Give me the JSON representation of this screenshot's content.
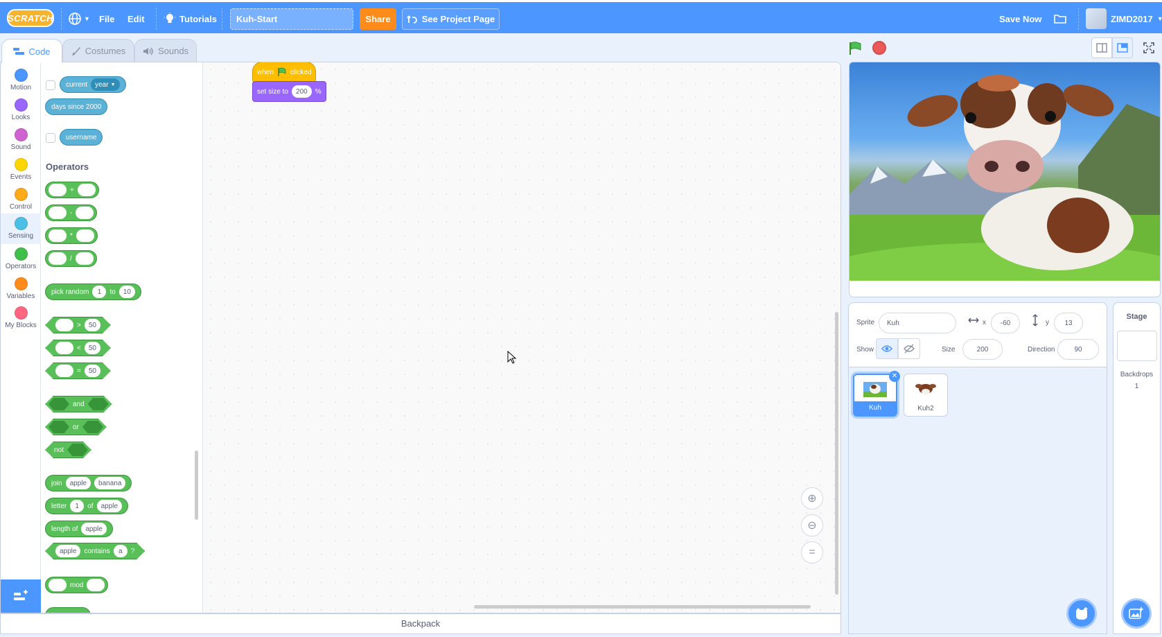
{
  "menubar": {
    "logo": "SCRATCH",
    "file": "File",
    "edit": "Edit",
    "tutorials": "Tutorials",
    "project_title": "Kuh-Start",
    "share": "Share",
    "see_project_page": "See Project Page",
    "save_now": "Save Now",
    "username": "ZIMD2017"
  },
  "tabs": {
    "code": "Code",
    "costumes": "Costumes",
    "sounds": "Sounds"
  },
  "categories": [
    {
      "label": "Motion",
      "color": "#4c97ff"
    },
    {
      "label": "Looks",
      "color": "#9966ff"
    },
    {
      "label": "Sound",
      "color": "#cf63cf"
    },
    {
      "label": "Events",
      "color": "#ffd500"
    },
    {
      "label": "Control",
      "color": "#ffab19"
    },
    {
      "label": "Sensing",
      "color": "#4cbfe6"
    },
    {
      "label": "Operators",
      "color": "#40bf4a"
    },
    {
      "label": "Variables",
      "color": "#ff8c1a"
    },
    {
      "label": "My Blocks",
      "color": "#ff6680"
    }
  ],
  "palette": {
    "current": "current",
    "current_option": "year",
    "days_since": "days since 2000",
    "username": "username",
    "operators_heading": "Operators",
    "plus": "+",
    "minus": "-",
    "times": "*",
    "divide": "/",
    "pick_random": "pick random",
    "pick_from": "1",
    "pick_to_label": "to",
    "pick_to": "10",
    "gt": ">",
    "lt": "<",
    "eq": "=",
    "cmp_value": "50",
    "and": "and",
    "or": "or",
    "not": "not",
    "join": "join",
    "join_a": "apple",
    "join_b": "banana",
    "letter": "letter",
    "letter_n": "1",
    "of": "of",
    "letter_str": "apple",
    "length_of": "length of",
    "length_str": "apple",
    "contains_str": "apple",
    "contains": "contains",
    "contains_char": "a",
    "contains_q": "?",
    "mod": "mod"
  },
  "script": {
    "when": "when",
    "clicked": "clicked",
    "set_size_to": "set size to",
    "size_value": "200",
    "percent": "%"
  },
  "backpack": "Backpack",
  "sprite": {
    "label": "Sprite",
    "name": "Kuh",
    "x_label": "x",
    "x": "-60",
    "y_label": "y",
    "y": "13",
    "show_label": "Show",
    "size_label": "Size",
    "size": "200",
    "direction_label": "Direction",
    "direction": "90"
  },
  "sprites": [
    {
      "name": "Kuh"
    },
    {
      "name": "Kuh2"
    }
  ],
  "stage_panel": {
    "title": "Stage",
    "backdrops_label": "Backdrops",
    "backdrops_count": "1"
  }
}
